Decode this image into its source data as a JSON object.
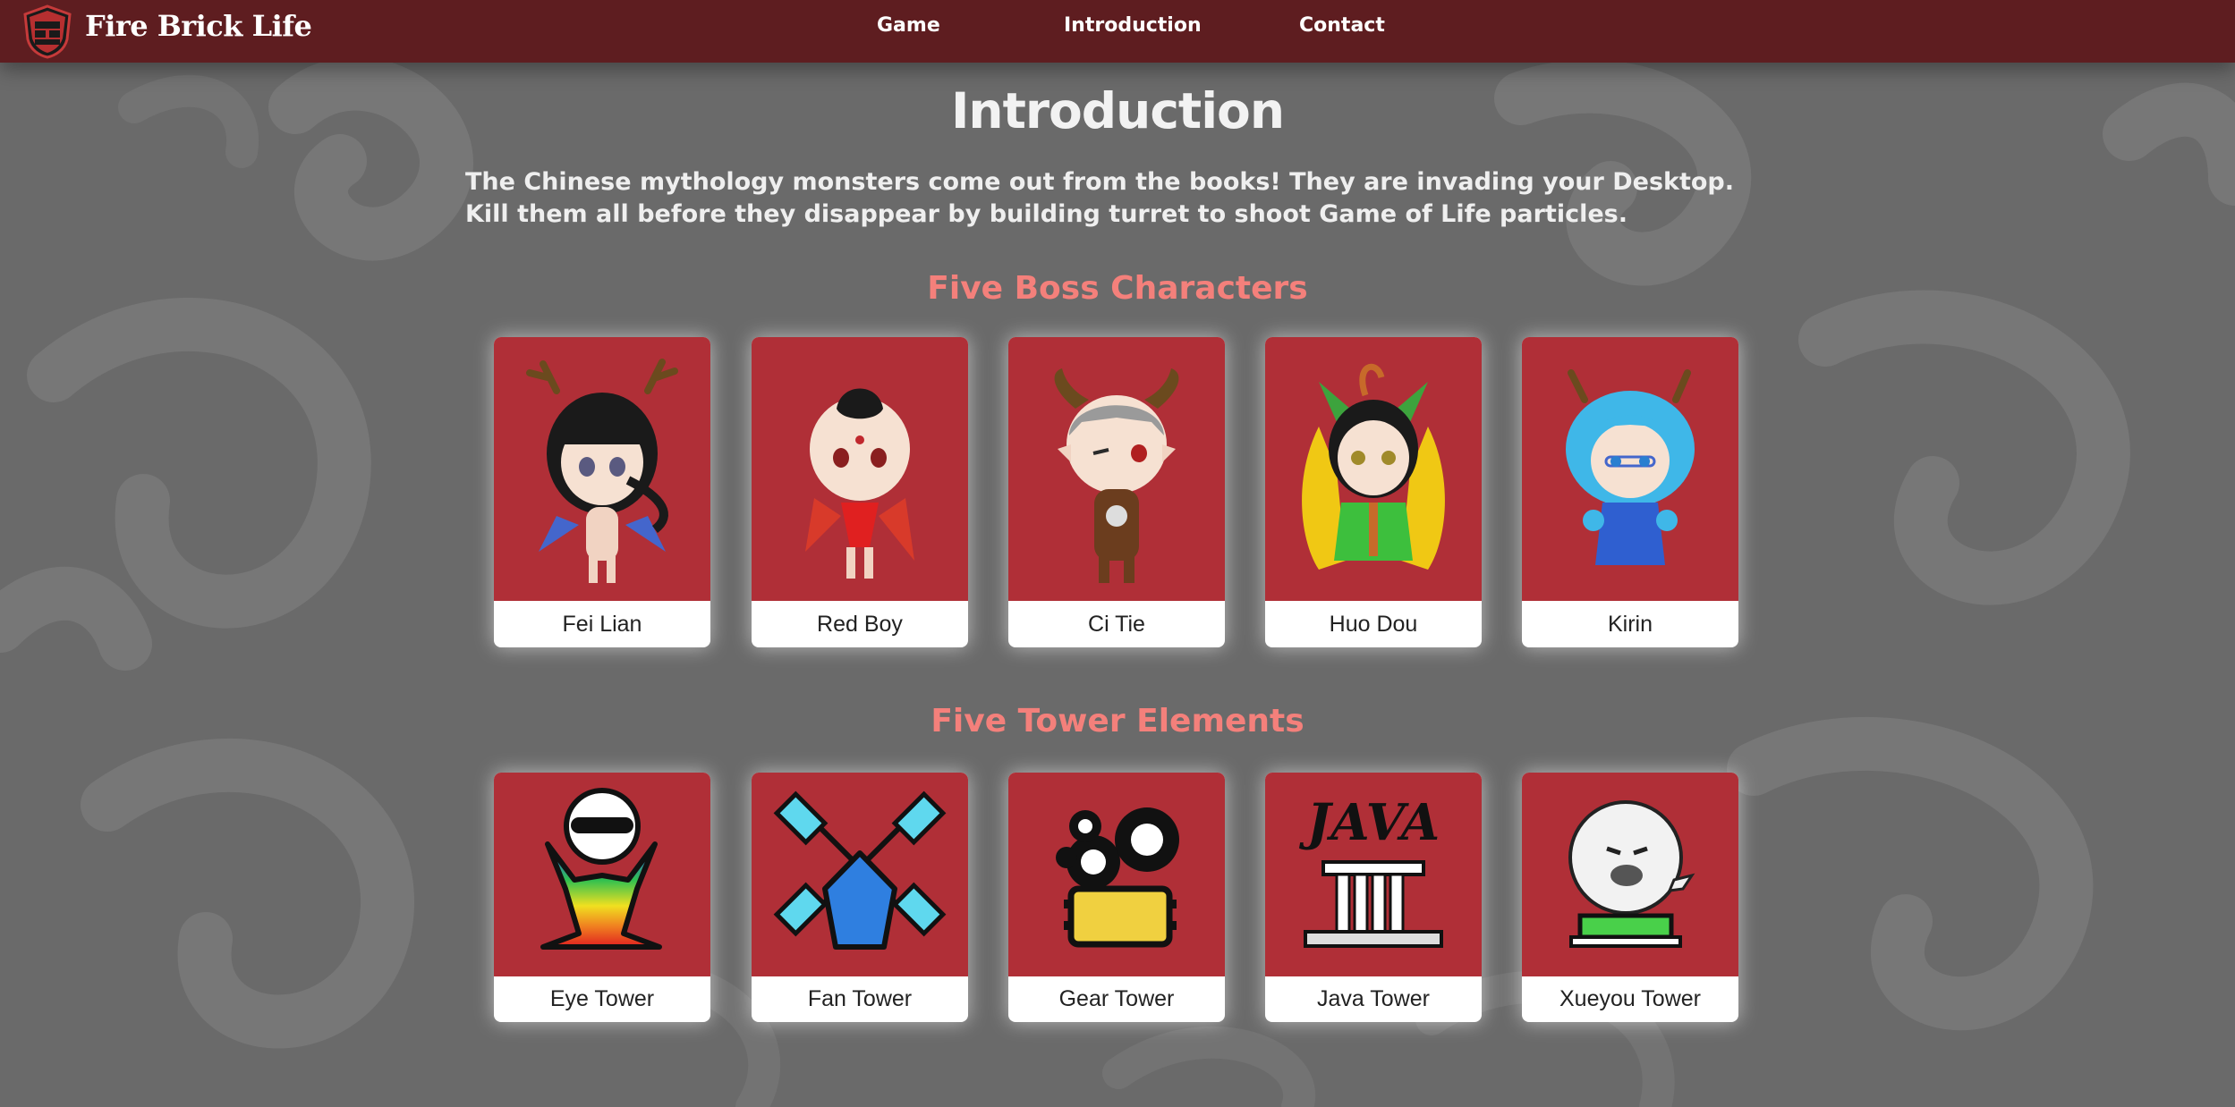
{
  "brand": {
    "name": "Fire Brick Life",
    "logo_icon": "fire-brick-shield-icon"
  },
  "nav": {
    "items": [
      {
        "label": "Game"
      },
      {
        "label": "Introduction"
      },
      {
        "label": "Contact"
      }
    ]
  },
  "page": {
    "title": "Introduction",
    "intro": "The Chinese mythology monsters come out from the books! They are invading your Desktop. Kill them all before they disappear by building turret to shoot Game of Life particles."
  },
  "bosses": {
    "heading": "Five Boss Characters",
    "items": [
      {
        "name": "Fei Lian",
        "icon": "fei-lian-character-icon"
      },
      {
        "name": "Red Boy",
        "icon": "red-boy-character-icon"
      },
      {
        "name": "Ci Tie",
        "icon": "ci-tie-character-icon"
      },
      {
        "name": "Huo Dou",
        "icon": "huo-dou-character-icon"
      },
      {
        "name": "Kirin",
        "icon": "kirin-character-icon"
      }
    ]
  },
  "towers": {
    "heading": "Five Tower Elements",
    "items": [
      {
        "name": "Eye Tower",
        "icon": "eye-tower-icon"
      },
      {
        "name": "Fan Tower",
        "icon": "fan-tower-icon"
      },
      {
        "name": "Gear Tower",
        "icon": "gear-tower-icon"
      },
      {
        "name": "Java Tower",
        "icon": "java-tower-icon",
        "art_text": "JAVA"
      },
      {
        "name": "Xueyou Tower",
        "icon": "xueyou-tower-icon"
      }
    ]
  },
  "colors": {
    "navbar": "#5e1d20",
    "card_art": "#b02f37",
    "section_heading": "#f4807b",
    "background": "#6b6b6b"
  }
}
